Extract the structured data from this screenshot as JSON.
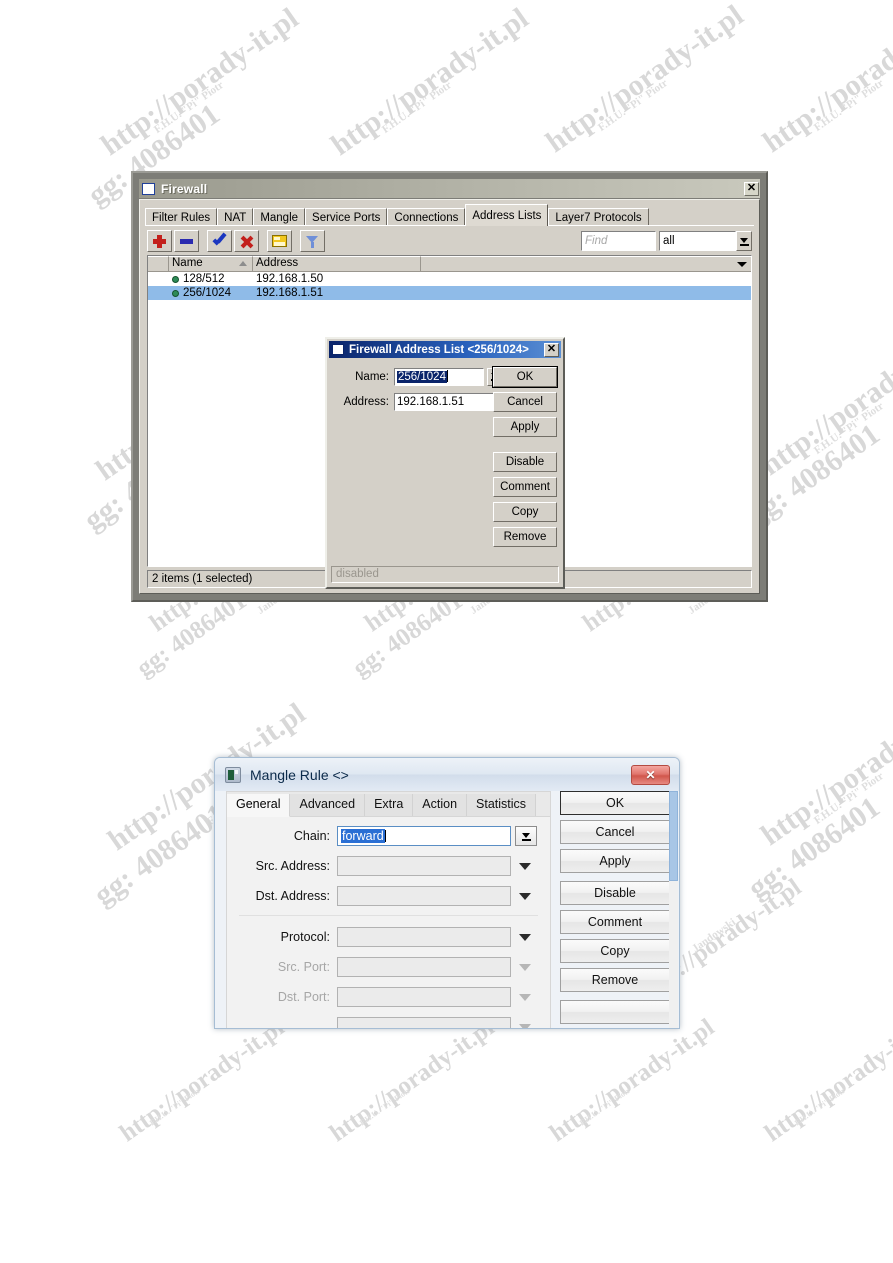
{
  "watermark": {
    "url": "http://porady-it.pl",
    "gg": "gg: 4086401",
    "company": "F.H.U. \"Pi\" Piotr",
    "author": "Jandowski"
  },
  "firewall_window": {
    "title": "Firewall",
    "close_label": "✕",
    "tabs": [
      {
        "label": "Filter Rules",
        "active": false
      },
      {
        "label": "NAT",
        "active": false
      },
      {
        "label": "Mangle",
        "active": false
      },
      {
        "label": "Service Ports",
        "active": false
      },
      {
        "label": "Connections",
        "active": false
      },
      {
        "label": "Address Lists",
        "active": true
      },
      {
        "label": "Layer7 Protocols",
        "active": false
      }
    ],
    "toolbar": [
      {
        "name": "add-button",
        "icon": "plus-icon"
      },
      {
        "name": "remove-button",
        "icon": "minus-icon"
      },
      {
        "name": "enable-button",
        "icon": "check-icon"
      },
      {
        "name": "disable-button",
        "icon": "cross-icon"
      },
      {
        "name": "comment-button",
        "icon": "folder-icon"
      },
      {
        "name": "filter-button",
        "icon": "funnel-icon"
      }
    ],
    "find_placeholder": "Find",
    "filter_value": "all",
    "columns": [
      "",
      "Name",
      "Address",
      ""
    ],
    "rows": [
      {
        "name": "128/512",
        "address": "192.168.1.50",
        "selected": false
      },
      {
        "name": "256/1024",
        "address": "192.168.1.51",
        "selected": true
      }
    ],
    "status": "2 items (1 selected)"
  },
  "address_dialog": {
    "title": "Firewall Address List <256/1024>",
    "close_label": "✕",
    "name_label": "Name:",
    "name_value": "256/1024",
    "address_label": "Address:",
    "address_value": "192.168.1.51",
    "buttons": [
      "OK",
      "Cancel",
      "Apply",
      "Disable",
      "Comment",
      "Copy",
      "Remove"
    ],
    "status": "disabled"
  },
  "mangle_dialog": {
    "title": "Mangle Rule <>",
    "close_label": "✕",
    "tabs": [
      {
        "label": "General",
        "active": true
      },
      {
        "label": "Advanced",
        "active": false
      },
      {
        "label": "Extra",
        "active": false
      },
      {
        "label": "Action",
        "active": false
      },
      {
        "label": "Statistics",
        "active": false
      }
    ],
    "fields": [
      {
        "label": "Chain:",
        "value": "forward",
        "disabled": false,
        "focused": true,
        "control": "combo-button"
      },
      {
        "label": "Src. Address:",
        "value": "",
        "disabled": false,
        "focused": false,
        "control": "caret"
      },
      {
        "label": "Dst. Address:",
        "value": "",
        "disabled": false,
        "focused": false,
        "control": "caret"
      },
      {
        "label": "Protocol:",
        "value": "",
        "disabled": false,
        "focused": false,
        "control": "caret"
      },
      {
        "label": "Src. Port:",
        "value": "",
        "disabled": true,
        "focused": false,
        "control": "caret"
      },
      {
        "label": "Dst. Port:",
        "value": "",
        "disabled": true,
        "focused": false,
        "control": "caret"
      }
    ],
    "buttons": [
      "OK",
      "Cancel",
      "Apply",
      "Disable",
      "Comment",
      "Copy",
      "Remove"
    ]
  }
}
